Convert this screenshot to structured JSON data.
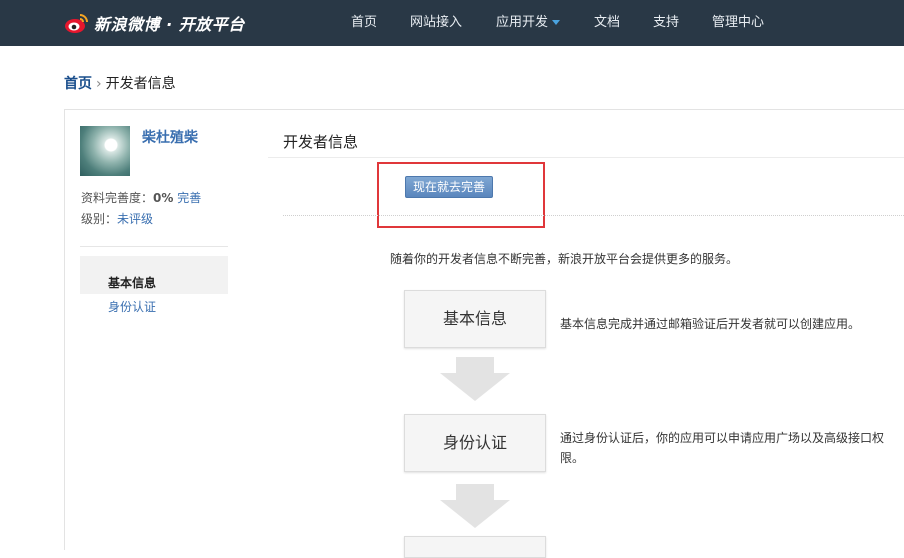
{
  "header": {
    "logo_text": "新浪微博 · 开放平台",
    "nav": [
      {
        "label": "首页"
      },
      {
        "label": "网站接入"
      },
      {
        "label": "应用开发"
      },
      {
        "label": "文档"
      },
      {
        "label": "支持"
      },
      {
        "label": "管理中心"
      }
    ]
  },
  "breadcrumb": {
    "home": "首页",
    "separator": "›",
    "current": "开发者信息"
  },
  "sidebar": {
    "username": "柴杜殖柴",
    "completeness_label": "资料完善度：",
    "completeness_value": "0%",
    "complete_link": "完善",
    "level_label": "级别：",
    "level_value": "未评级",
    "menu": [
      {
        "label": "基本信息",
        "active": true
      },
      {
        "label": "身份认证",
        "active": false
      }
    ]
  },
  "main": {
    "title": "开发者信息",
    "complete_button": "现在就去完善",
    "intro": "随着你的开发者信息不断完善，新浪开放平台会提供更多的服务。",
    "steps": [
      {
        "label": "基本信息",
        "desc": "基本信息完成并通过邮箱验证后开发者就可以创建应用。"
      },
      {
        "label": "身份认证",
        "desc_line1": "通过身份认证后，你的应用可以申请应用广场以及高级接口权",
        "desc_line2": "限。"
      }
    ]
  },
  "colors": {
    "topbar": "#293846",
    "link": "#3a6fb0",
    "highlight": "#e0373a"
  }
}
